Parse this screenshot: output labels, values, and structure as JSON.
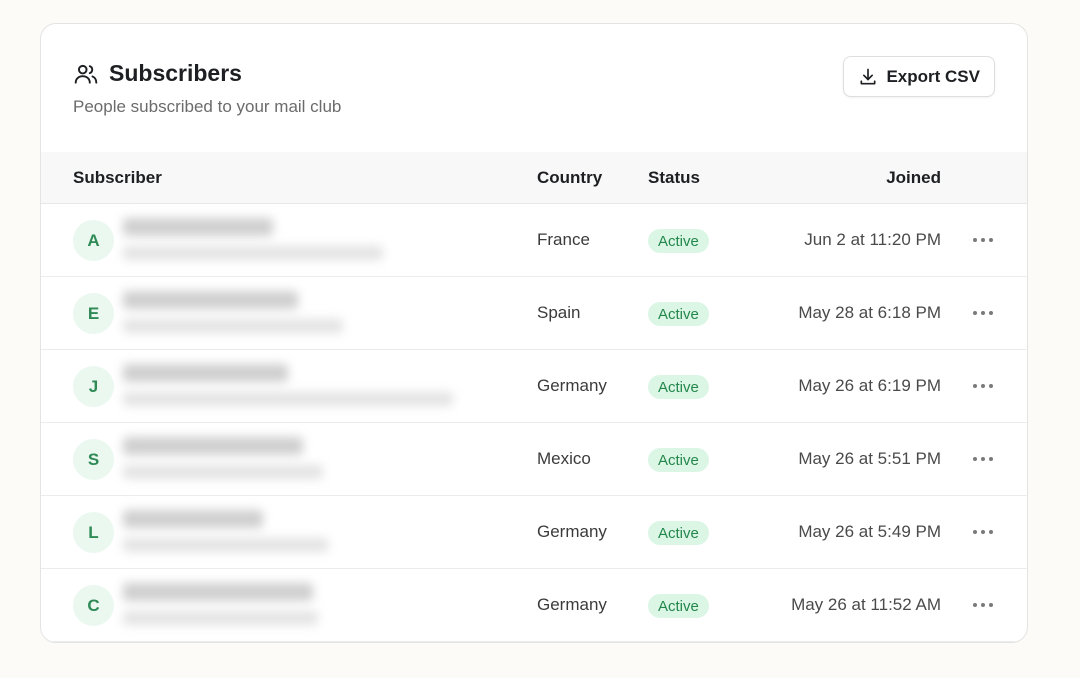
{
  "header": {
    "title": "Subscribers",
    "subtitle": "People subscribed to your mail club",
    "export_label": "Export CSV"
  },
  "columns": {
    "subscriber": "Subscriber",
    "country": "Country",
    "status": "Status",
    "joined": "Joined"
  },
  "rows": [
    {
      "initial": "A",
      "country": "France",
      "status": "Active",
      "joined": "Jun 2 at 11:20 PM"
    },
    {
      "initial": "E",
      "country": "Spain",
      "status": "Active",
      "joined": "May 28 at 6:18 PM"
    },
    {
      "initial": "J",
      "country": "Germany",
      "status": "Active",
      "joined": "May 26 at 6:19 PM"
    },
    {
      "initial": "S",
      "country": "Mexico",
      "status": "Active",
      "joined": "May 26 at 5:51 PM"
    },
    {
      "initial": "L",
      "country": "Germany",
      "status": "Active",
      "joined": "May 26 at 5:49 PM"
    },
    {
      "initial": "C",
      "country": "Germany",
      "status": "Active",
      "joined": "May 26 at 11:52 AM"
    }
  ],
  "icons": {
    "title": "users-icon",
    "export": "download-icon",
    "row_menu": "more-horizontal-icon"
  },
  "colors": {
    "accent_green": "#23874b",
    "badge_bg": "#dcf6e6",
    "avatar_bg": "#eaf8f0"
  }
}
